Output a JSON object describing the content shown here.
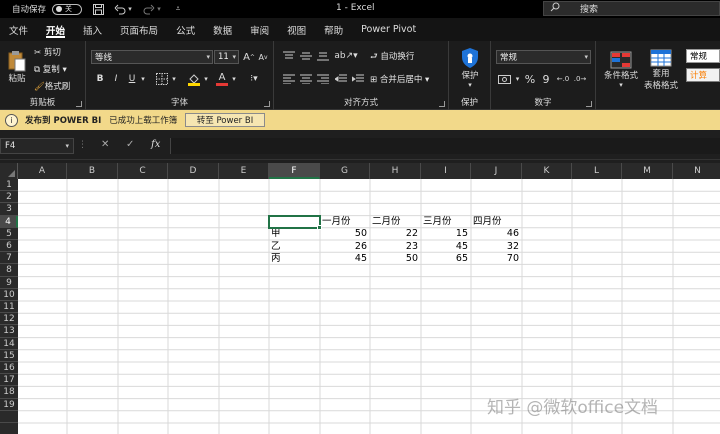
{
  "titlebar": {
    "autosave_label": "自动保存",
    "autosave_state": "关",
    "window_title": "1  -  Excel",
    "search_placeholder": "搜索",
    "save_icon": "save-icon",
    "undo_icon": "undo-icon",
    "redo_icon": "redo-icon"
  },
  "tabs": [
    "文件",
    "开始",
    "插入",
    "页面布局",
    "公式",
    "数据",
    "审阅",
    "视图",
    "帮助",
    "Power Pivot"
  ],
  "active_tab": "开始",
  "ribbon": {
    "clipboard": {
      "label": "剪贴板",
      "paste": "粘贴",
      "cut": "剪切",
      "copy": "复制",
      "format_painter": "格式刷"
    },
    "font": {
      "label": "字体",
      "font_name": "等线",
      "font_size": "11",
      "bold": "B",
      "italic": "I",
      "underline": "U",
      "grow": "A",
      "shrink": "A"
    },
    "alignment": {
      "label": "对齐方式",
      "wrap_text": "自动换行",
      "merge_center": "合并后居中"
    },
    "protect": {
      "label": "保护",
      "button": "保护"
    },
    "number": {
      "label": "数字",
      "format": "常规",
      "percent": "%",
      "comma": "9"
    },
    "styles": {
      "conditional": "条件格式",
      "table_format_line1": "套用",
      "table_format_line2": "表格格式",
      "style_normal": "常规",
      "style_calc": "计算"
    }
  },
  "infobar": {
    "title": "发布到 POWER BI",
    "message": "已成功上载工作簿",
    "button": "转至 Power BI"
  },
  "formulabar": {
    "name_box": "F4",
    "cancel": "✕",
    "enter": "✓",
    "fx": "fx",
    "formula": ""
  },
  "grid": {
    "columns": [
      "A",
      "B",
      "C",
      "D",
      "E",
      "F",
      "G",
      "H",
      "I",
      "J",
      "K",
      "L",
      "M",
      "N"
    ],
    "rows": [
      "1",
      "2",
      "3",
      "4",
      "5",
      "6",
      "7",
      "8",
      "9",
      "10",
      "11",
      "12",
      "13",
      "14",
      "15",
      "16",
      "17",
      "18",
      "19"
    ],
    "selected_column": "F",
    "selected_row": "4",
    "headers": [
      "一月份",
      "二月份",
      "三月份",
      "四月份"
    ],
    "data_rows": [
      {
        "label": "甲",
        "values": [
          "50",
          "22",
          "15",
          "46"
        ]
      },
      {
        "label": "乙",
        "values": [
          "26",
          "23",
          "45",
          "32"
        ]
      },
      {
        "label": "丙",
        "values": [
          "45",
          "50",
          "65",
          "70"
        ]
      }
    ]
  },
  "watermark": "知乎 @微软office文档"
}
